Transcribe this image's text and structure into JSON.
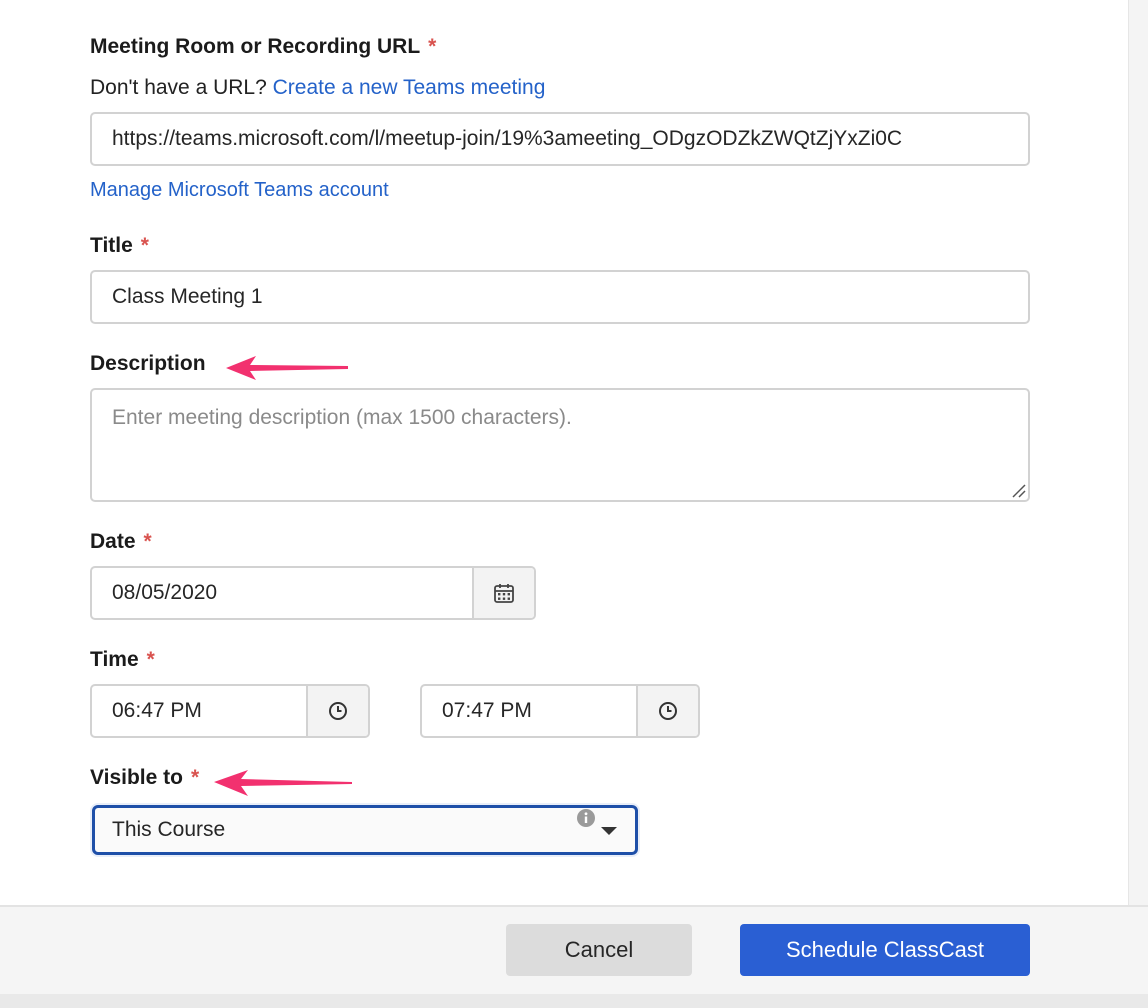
{
  "url_section": {
    "label": "Meeting Room or Recording URL",
    "required_mark": "*",
    "helper_text": "Don't have a URL?",
    "create_link": "Create a new Teams meeting",
    "url_value": "https://teams.microsoft.com/l/meetup-join/19%3ameeting_ODgzODZkZWQtZjYxZi0C",
    "manage_link": "Manage Microsoft Teams account"
  },
  "title_section": {
    "label": "Title",
    "required_mark": "*",
    "value": "Class Meeting 1"
  },
  "description_section": {
    "label": "Description",
    "placeholder": "Enter meeting description (max 1500 characters)."
  },
  "date_section": {
    "label": "Date",
    "required_mark": "*",
    "value": "08/05/2020",
    "icon": "calendar-icon"
  },
  "time_section": {
    "label": "Time",
    "required_mark": "*",
    "start": "06:47 PM",
    "end": "07:47 PM",
    "icon": "clock-icon"
  },
  "visibility_section": {
    "label": "Visible to",
    "required_mark": "*",
    "selected": "This Course",
    "info_icon": "info-icon"
  },
  "footer": {
    "cancel_label": "Cancel",
    "submit_label": "Schedule ClassCast"
  },
  "colors": {
    "link": "#2462c9",
    "required": "#d9534f",
    "primary_button": "#2a5fd3",
    "annotation_arrow": "#f2316f",
    "select_focus": "#1e4fa8"
  }
}
